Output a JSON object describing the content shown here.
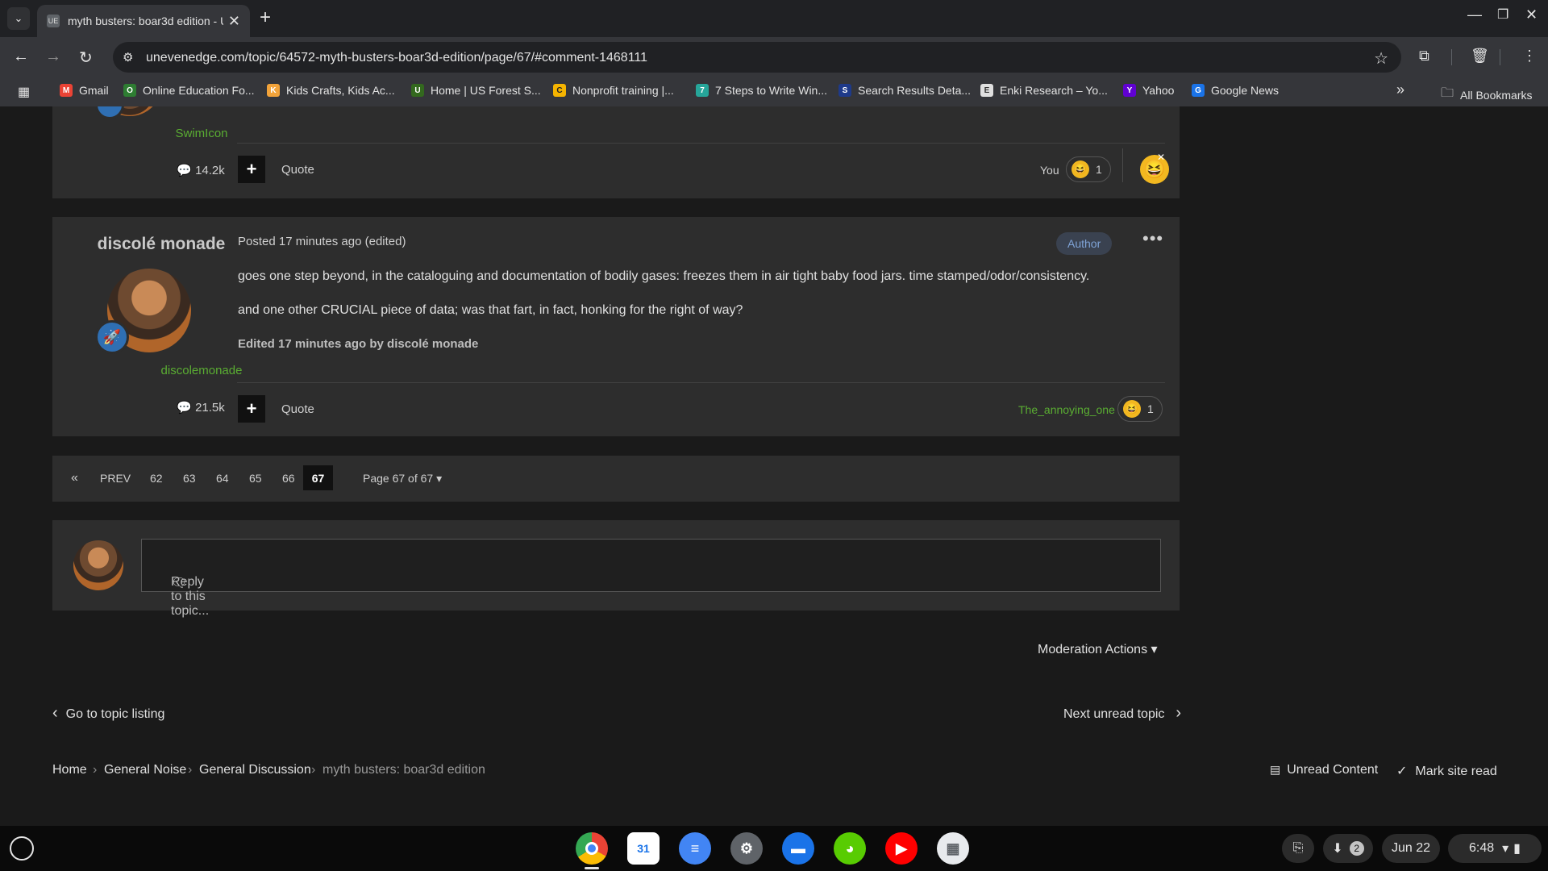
{
  "browser": {
    "tab_title": "myth busters: boar3d edition - U",
    "url": "unevenedge.com/topic/64572-myth-busters-boar3d-edition/page/67/#comment-1468111",
    "bookmarks": [
      {
        "label": "Gmail",
        "icon": "M",
        "color": "#ea4335"
      },
      {
        "label": "Online Education Fo...",
        "icon": "O",
        "color": "#2e7d32"
      },
      {
        "label": "Kids Crafts, Kids Ac...",
        "icon": "K",
        "color": "#f2a33a"
      },
      {
        "label": "Home | US Forest S...",
        "icon": "U",
        "color": "#33691e"
      },
      {
        "label": "Nonprofit training |...",
        "icon": "C",
        "color": "#f5b400"
      },
      {
        "label": "7 Steps to Write Win...",
        "icon": "7",
        "color": "#26a69a"
      },
      {
        "label": "Search Results Deta...",
        "icon": "S",
        "color": "#1e3a8a"
      },
      {
        "label": "Enki Research – Yo...",
        "icon": "E",
        "color": "#e0e0e0"
      },
      {
        "label": "Yahoo",
        "icon": "Y",
        "color": "#6001d2"
      },
      {
        "label": "Google News",
        "icon": "G",
        "color": "#1a73e8"
      }
    ],
    "all_bookmarks": "All Bookmarks",
    "overflow": "»"
  },
  "prev_post": {
    "username": "SwimIcon",
    "post_count": "14.2k",
    "quote": "Quote",
    "reaction_by": "You",
    "reaction_count": "1"
  },
  "post": {
    "author": "discolé monade",
    "posted": "Posted 17 minutes ago (edited)",
    "badge": "Author",
    "paragraphs": [
      "goes one step beyond, in the cataloguing and documentation of bodily gases: freezes them in air tight baby food jars. time stamped/odor/consistency.",
      "and one other CRUCIAL piece of data; was that fart, in fact, honking for the right of way?"
    ],
    "edit_note": "Edited 17 minutes ago by discolé monade",
    "username": "discolemonade",
    "post_count": "21.5k",
    "quote": "Quote",
    "reaction_by": "The_annoying_one",
    "reaction_count": "1"
  },
  "pagination": {
    "first": "«",
    "prev": "PREV",
    "pages": [
      "62",
      "63",
      "64",
      "65",
      "66",
      "67"
    ],
    "current": "67",
    "page_of": "Page 67 of 67"
  },
  "reply": {
    "placeholder": "Reply to this topic..."
  },
  "footer": {
    "moderation": "Moderation Actions",
    "go_topic_listing": "Go to topic listing",
    "next_unread": "Next unread topic",
    "breadcrumb": [
      "Home",
      "General Noise",
      "General Discussion",
      "myth busters: boar3d edition"
    ],
    "unread_content": "Unread Content",
    "mark_site_read": "Mark site read"
  },
  "shelf": {
    "apps": [
      {
        "name": "chrome",
        "label": "◉",
        "color": "#1a73e8"
      },
      {
        "name": "calendar",
        "label": "31",
        "color": "#ffffff"
      },
      {
        "name": "docs",
        "label": "≡",
        "color": "#4285f4"
      },
      {
        "name": "settings",
        "label": "⚙",
        "color": "#5f6368"
      },
      {
        "name": "files",
        "label": "▬",
        "color": "#1a73e8"
      },
      {
        "name": "duolingo",
        "label": "◕",
        "color": "#58cc02"
      },
      {
        "name": "youtube",
        "label": "▶",
        "color": "#ff0000"
      },
      {
        "name": "screenshot",
        "label": "▦",
        "color": "#e8eaed"
      }
    ],
    "notifications": "2",
    "date": "Jun 22",
    "time": "6:48"
  },
  "colors": {
    "accent_green": "#5aad32",
    "author_badge": "#7fa3d6"
  }
}
